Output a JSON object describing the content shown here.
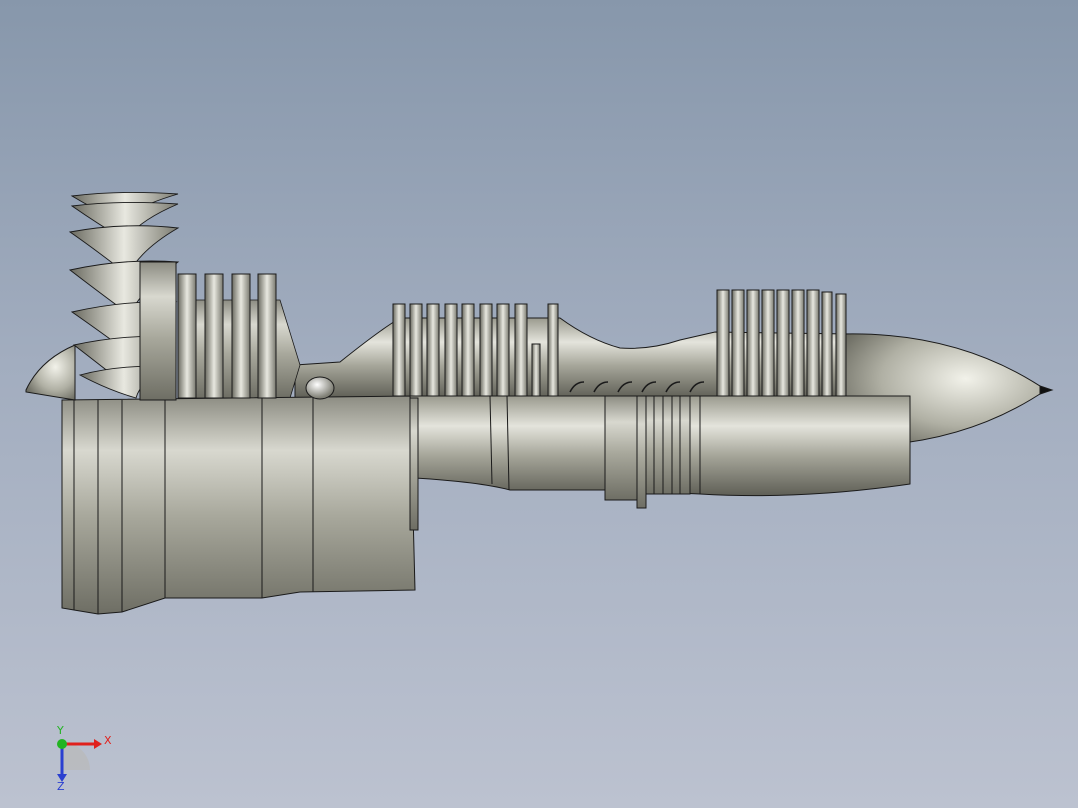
{
  "viewport": {
    "colors": {
      "bg_top": "#8797ab",
      "bg_bottom": "#bcc2d0",
      "metal": "#b5b5a8",
      "edge": "#1a1a1a"
    }
  },
  "model": {
    "icon": "turbofan-engine-model"
  },
  "triad": {
    "icon": "axis-triad-icon",
    "x_label": "X",
    "y_label": "Y",
    "z_label": "Z",
    "colors": {
      "x": "#e0201c",
      "y": "#22b422",
      "z": "#2a3fd0"
    }
  }
}
